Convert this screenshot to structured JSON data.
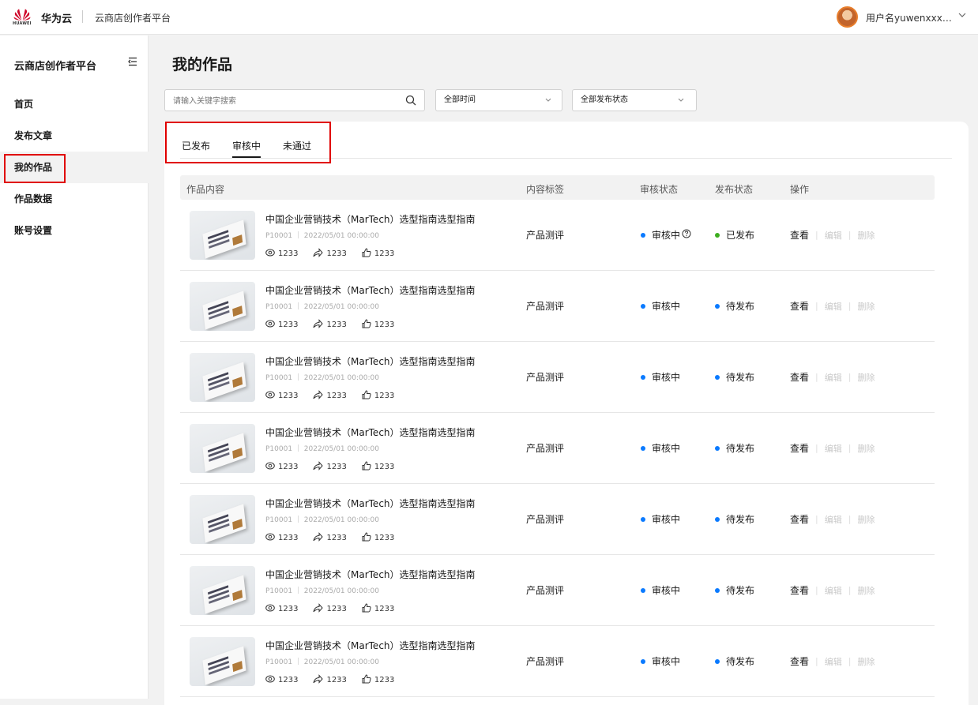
{
  "header": {
    "brand": "华为云",
    "logo_text": "HUAWEI",
    "platform": "云商店创作者平台",
    "username": "用户名yuwenxxx…"
  },
  "sidebar": {
    "title": "云商店创作者平台",
    "items": [
      {
        "label": "首页"
      },
      {
        "label": "发布文章"
      },
      {
        "label": "我的作品",
        "active": true
      },
      {
        "label": "作品数据"
      },
      {
        "label": "账号设置"
      }
    ]
  },
  "main": {
    "title": "我的作品",
    "search_placeholder": "请输入关键字搜索",
    "filter_time": "全部时间",
    "filter_status": "全部发布状态",
    "tabs": [
      {
        "label": "已发布"
      },
      {
        "label": "审核中",
        "active": true
      },
      {
        "label": "未通过"
      }
    ],
    "columns": [
      "作品内容",
      "内容标签",
      "审核状态",
      "发布状态",
      "操作"
    ],
    "ops": {
      "view": "查看",
      "edit": "编辑",
      "delete": "删除"
    },
    "rows": [
      {
        "title": "中国企业营销技术（MarTech）选型指南选型指南",
        "meta": "P10001 ｜ 2022/05/01 00:00:00",
        "views": "1233",
        "shares": "1233",
        "likes": "1233",
        "tag": "产品测评",
        "review": "审核中",
        "review_help": true,
        "publish": "已发布",
        "publish_color": "#3dae1f"
      },
      {
        "title": "中国企业营销技术（MarTech）选型指南选型指南",
        "meta": "P10001 ｜ 2022/05/01 00:00:00",
        "views": "1233",
        "shares": "1233",
        "likes": "1233",
        "tag": "产品测评",
        "review": "审核中",
        "review_help": false,
        "publish": "待发布",
        "publish_color": "#0a7aff"
      },
      {
        "title": "中国企业营销技术（MarTech）选型指南选型指南",
        "meta": "P10001 ｜ 2022/05/01 00:00:00",
        "views": "1233",
        "shares": "1233",
        "likes": "1233",
        "tag": "产品测评",
        "review": "审核中",
        "review_help": false,
        "publish": "待发布",
        "publish_color": "#0a7aff"
      },
      {
        "title": "中国企业营销技术（MarTech）选型指南选型指南",
        "meta": "P10001 ｜ 2022/05/01 00:00:00",
        "views": "1233",
        "shares": "1233",
        "likes": "1233",
        "tag": "产品测评",
        "review": "审核中",
        "review_help": false,
        "publish": "待发布",
        "publish_color": "#0a7aff"
      },
      {
        "title": "中国企业营销技术（MarTech）选型指南选型指南",
        "meta": "P10001 ｜ 2022/05/01 00:00:00",
        "views": "1233",
        "shares": "1233",
        "likes": "1233",
        "tag": "产品测评",
        "review": "审核中",
        "review_help": false,
        "publish": "待发布",
        "publish_color": "#0a7aff"
      },
      {
        "title": "中国企业营销技术（MarTech）选型指南选型指南",
        "meta": "P10001 ｜ 2022/05/01 00:00:00",
        "views": "1233",
        "shares": "1233",
        "likes": "1233",
        "tag": "产品测评",
        "review": "审核中",
        "review_help": false,
        "publish": "待发布",
        "publish_color": "#0a7aff"
      },
      {
        "title": "中国企业营销技术（MarTech）选型指南选型指南",
        "meta": "P10001 ｜ 2022/05/01 00:00:00",
        "views": "1233",
        "shares": "1233",
        "likes": "1233",
        "tag": "产品测评",
        "review": "审核中",
        "review_help": false,
        "publish": "待发布",
        "publish_color": "#0a7aff"
      }
    ]
  },
  "colors": {
    "review_dot": "#0a7aff",
    "highlight": "#e00000",
    "brand_red": "#cf0a2c"
  }
}
